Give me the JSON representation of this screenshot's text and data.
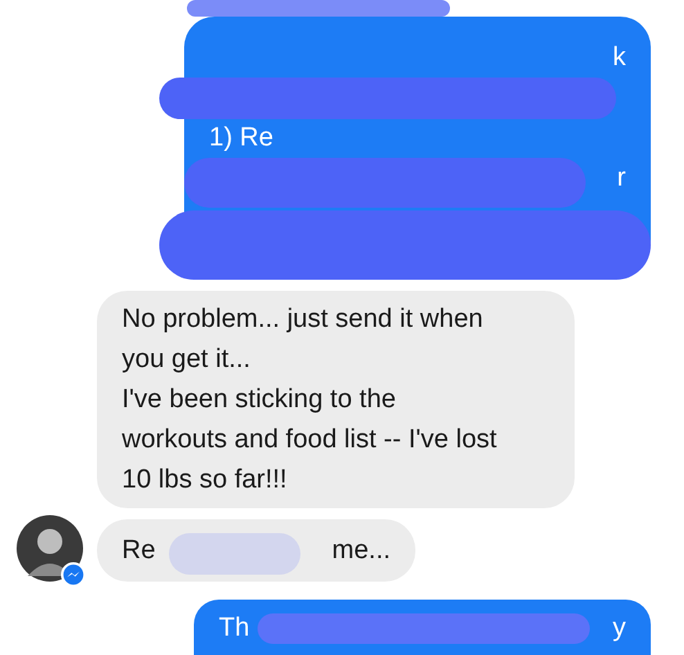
{
  "messages": [
    {
      "kind": "outgoing",
      "redacted": true,
      "lines": [
        {
          "kind": "text",
          "right": "k"
        },
        {
          "kind": "blank"
        },
        {
          "kind": "text",
          "left": "1) Re"
        },
        {
          "kind": "text",
          "right": "r"
        }
      ]
    },
    {
      "kind": "incoming",
      "redacted": false,
      "avatar": false,
      "lines": [
        {
          "kind": "text",
          "left": "No problem... just send it when"
        },
        {
          "kind": "text",
          "left": "you get it..."
        },
        {
          "kind": "text",
          "left": "I've been sticking to the"
        },
        {
          "kind": "text",
          "left": "workouts and food list -- I've lost"
        },
        {
          "kind": "text",
          "left": "10 lbs so far!!!"
        }
      ]
    },
    {
      "kind": "incoming",
      "redacted": true,
      "avatar": true,
      "lines": [
        {
          "kind": "text",
          "left": "Re",
          "right": "me..."
        }
      ]
    },
    {
      "kind": "outgoing",
      "redacted": true,
      "lines": [
        {
          "kind": "text",
          "left": "Th",
          "right": "y"
        }
      ]
    }
  ]
}
